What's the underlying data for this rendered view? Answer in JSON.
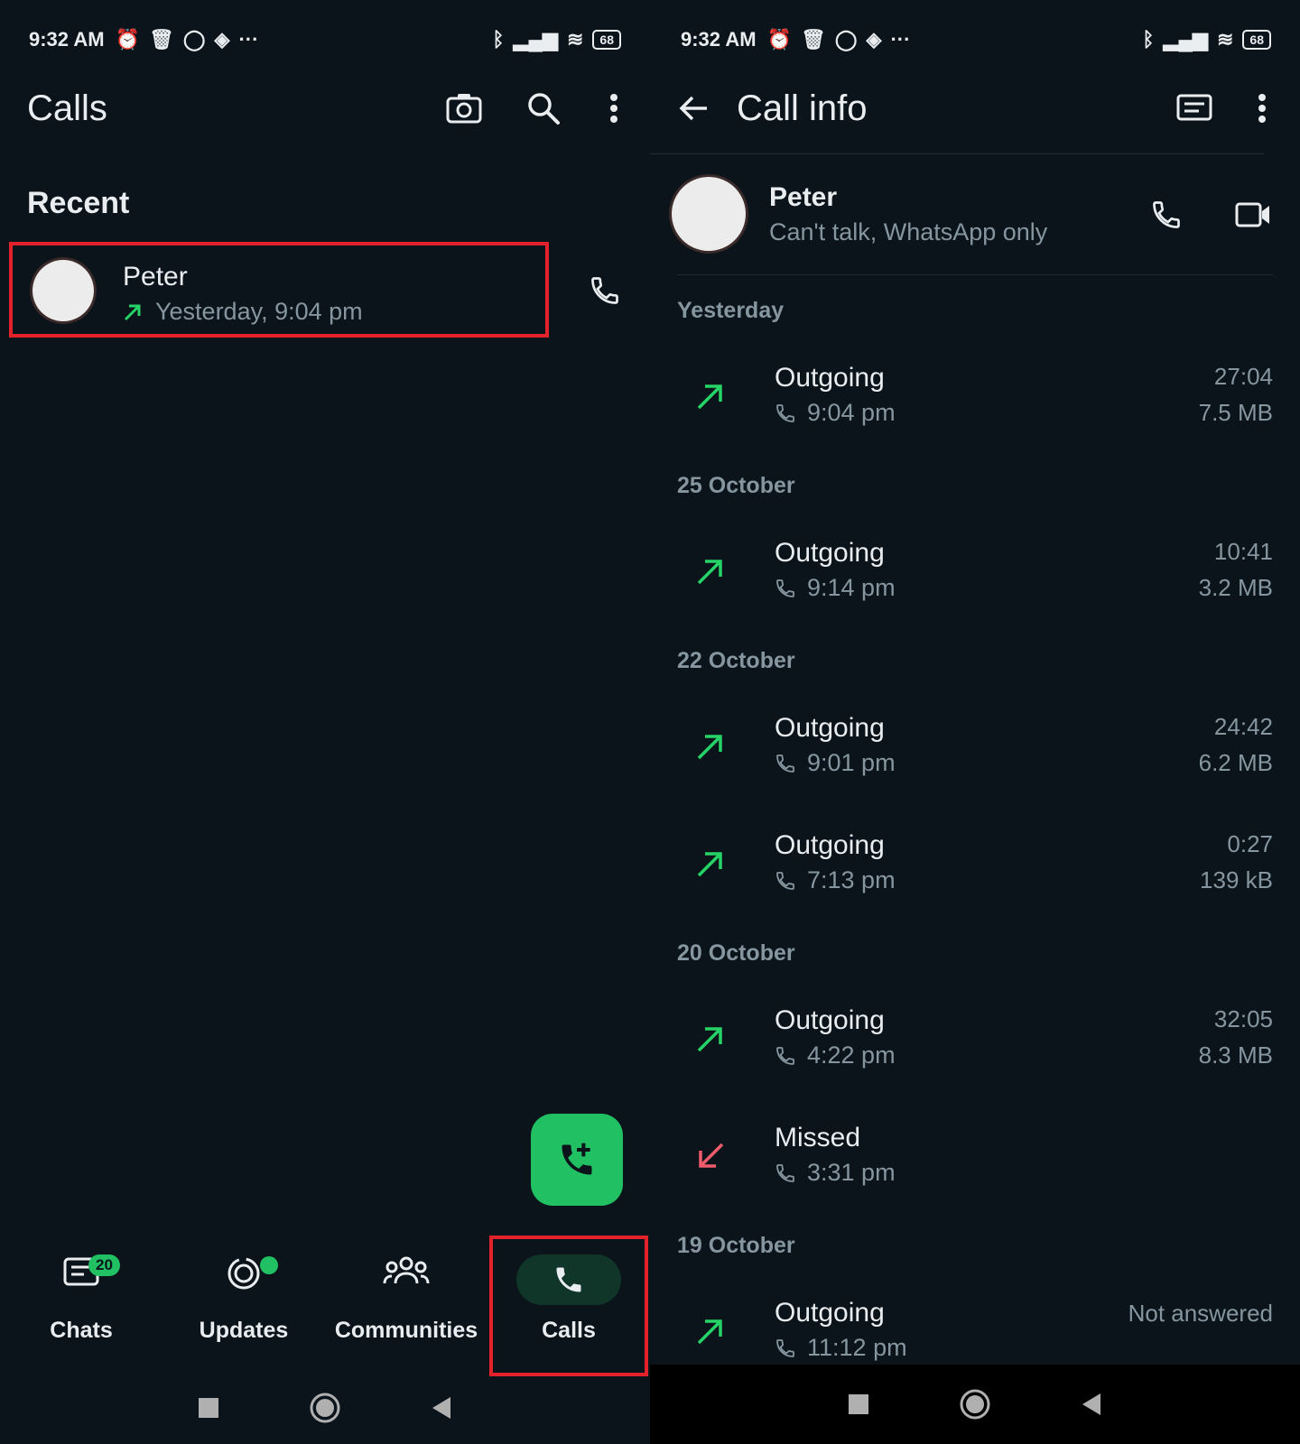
{
  "status_bar": {
    "time": "9:32 AM",
    "battery": "68"
  },
  "calls_screen": {
    "title": "Calls",
    "section_title": "Recent",
    "recent_call": {
      "name": "Peter",
      "detail": "Yesterday, 9:04 pm"
    },
    "bottom_nav": [
      {
        "label": "Chats",
        "badge": "20"
      },
      {
        "label": "Updates"
      },
      {
        "label": "Communities"
      },
      {
        "label": "Calls"
      }
    ]
  },
  "call_info_screen": {
    "title": "Call info",
    "contact": {
      "name": "Peter",
      "status": "Can't talk, WhatsApp only"
    },
    "groups": [
      {
        "date": "Yesterday",
        "calls": [
          {
            "type": "Outgoing",
            "time": "9:04 pm",
            "duration": "27:04",
            "size": "7.5 MB",
            "direction": "out"
          }
        ]
      },
      {
        "date": "25 October",
        "calls": [
          {
            "type": "Outgoing",
            "time": "9:14 pm",
            "duration": "10:41",
            "size": "3.2 MB",
            "direction": "out"
          }
        ]
      },
      {
        "date": "22 October",
        "calls": [
          {
            "type": "Outgoing",
            "time": "9:01 pm",
            "duration": "24:42",
            "size": "6.2 MB",
            "direction": "out"
          },
          {
            "type": "Outgoing",
            "time": "7:13 pm",
            "duration": "0:27",
            "size": "139 kB",
            "direction": "out"
          }
        ]
      },
      {
        "date": "20 October",
        "calls": [
          {
            "type": "Outgoing",
            "time": "4:22 pm",
            "duration": "32:05",
            "size": "8.3 MB",
            "direction": "out"
          },
          {
            "type": "Missed",
            "time": "3:31 pm",
            "direction": "missed"
          }
        ]
      },
      {
        "date": "19 October",
        "calls": [
          {
            "type": "Outgoing",
            "time": "11:12 pm",
            "note": "Not answered",
            "direction": "out"
          }
        ]
      }
    ]
  },
  "colors": {
    "background": "#0b141a",
    "accent_green": "#21c063",
    "missed_red": "#f15c6d",
    "highlight_red": "#e3222b"
  },
  "icons": [
    "camera-icon",
    "search-icon",
    "more-vert-icon",
    "phone-icon",
    "add-call-icon",
    "chats-icon",
    "updates-icon",
    "communities-icon",
    "back-arrow-icon",
    "message-icon",
    "video-icon",
    "outgoing-arrow-icon",
    "missed-arrow-icon"
  ]
}
